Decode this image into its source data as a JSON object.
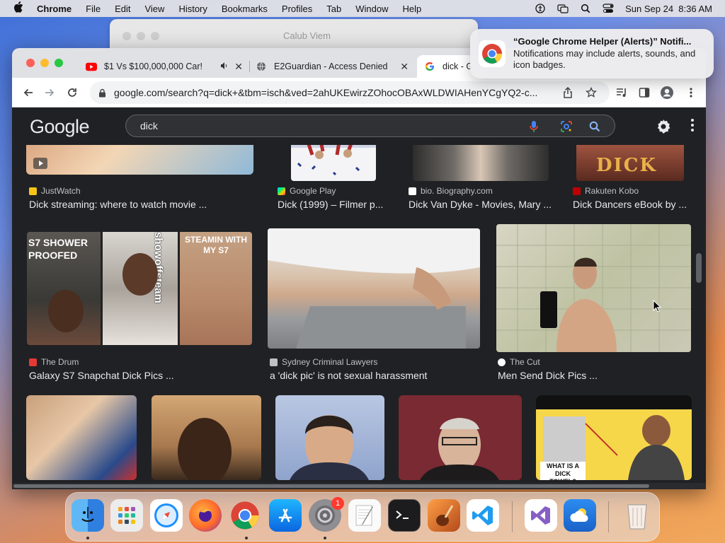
{
  "menubar": {
    "app": "Chrome",
    "items": [
      "File",
      "Edit",
      "View",
      "History",
      "Bookmarks",
      "Profiles",
      "Tab",
      "Window",
      "Help"
    ],
    "clock": "Sun Sep 24  8:36 AM",
    "status_icons": [
      "accessibility-icon",
      "screen-mirror-icon",
      "spotlight-search-icon",
      "control-center-icon"
    ]
  },
  "background_window": {
    "title": "Calub Viem"
  },
  "tabs": [
    {
      "title": "$1 Vs $100,000,000 Car!",
      "icon": "youtube-icon",
      "muted_icon": "speaker-icon"
    },
    {
      "title": "E2Guardian - Access Denied",
      "icon": "globe-icon"
    },
    {
      "title": "dick - G",
      "icon": "google-icon"
    }
  ],
  "toolbar": {
    "url": "google.com/search?q=dick+&tbm=isch&ved=2ahUKEwirzZOhocOBAxWLDWIAHenYCgYQ2-c..."
  },
  "google": {
    "logo": "Google",
    "query": "dick"
  },
  "results_row1": [
    {
      "source": "JustWatch",
      "title": "Dick streaming: where to watch movie ...",
      "fav_color": "#f5c518"
    },
    {
      "source": "Google Play",
      "title": "Dick (1999) – Filmer p...",
      "fav_color": "#34a853"
    },
    {
      "source": "bio. Biography.com",
      "title": "Dick Van Dyke - Movies, Mary ...",
      "fav_color": "#ffffff"
    },
    {
      "source": "Rakuten Kobo",
      "title": "Dick Dancers eBook by ...",
      "fav_color": "#bf0000"
    }
  ],
  "results_row2": [
    {
      "source": "The Drum",
      "title": "Galaxy S7 Snapchat Dick Pics ...",
      "fav_color": "#e53935"
    },
    {
      "source": "Sydney Criminal Lawyers",
      "title": "a 'dick pic' is not sexual harassment",
      "fav_color": "#bdc1c6"
    },
    {
      "source": "The Cut",
      "title": "Men Send Dick Pics ...",
      "fav_color": "#ffffff"
    }
  ],
  "thumb_text": {
    "s7_left": "S7 SHOWER PROOFED",
    "s7_right": "STEAMIN WITH MY S7",
    "s7_middle": "showoffsteam",
    "kobo": "DICK",
    "towel": "WHAT IS A DICK TOWEL?"
  },
  "notification": {
    "title": "“Google Chrome Helper (Alerts)” Notifi...",
    "body": "Notifications may include alerts, sounds, and icon badges."
  },
  "dock": {
    "apps": [
      "finder",
      "launchpad",
      "safari",
      "firefox",
      "chrome",
      "app-store",
      "system-settings",
      "textedit",
      "terminal",
      "garageband",
      "vscode",
      "visual-studio",
      "weather",
      "trash"
    ],
    "badge": "1"
  }
}
